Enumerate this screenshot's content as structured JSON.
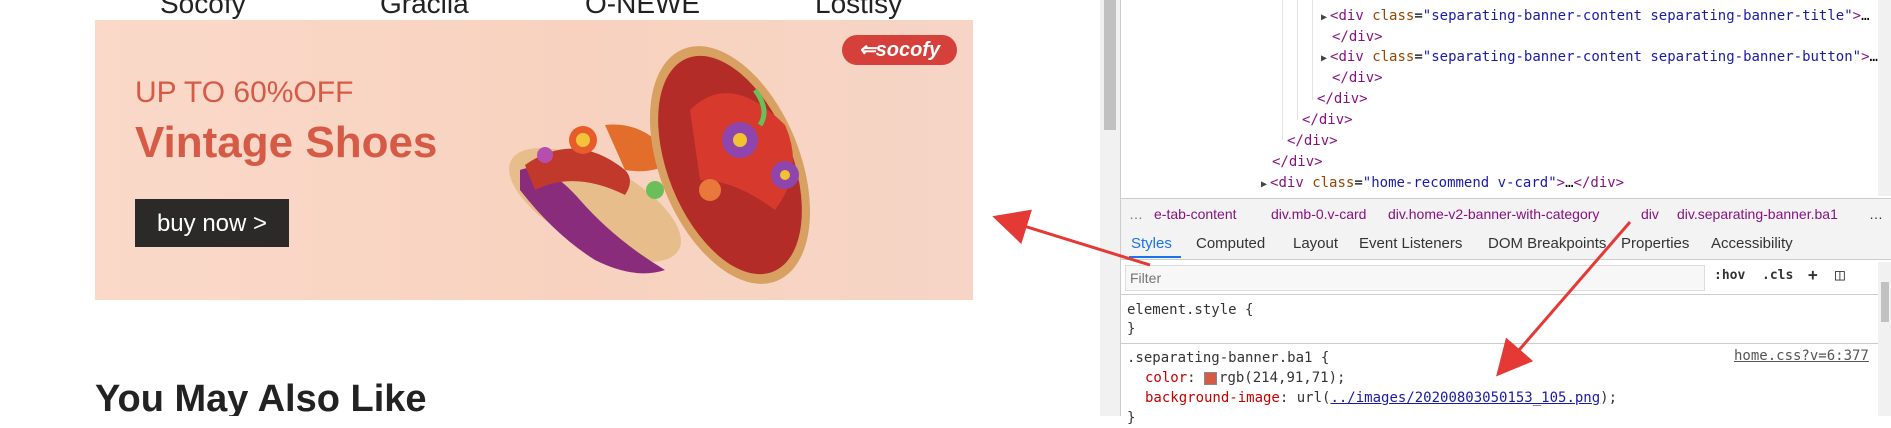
{
  "brands": [
    "Socofy",
    "Gracila",
    "O-NEWE",
    "Lostisy"
  ],
  "banner": {
    "promo": "UP TO 60%OFF",
    "headline": "Vintage Shoes",
    "button": "buy now >",
    "logo": "socofy",
    "text_color": "#d65b47",
    "background_color": "#f9d5c3"
  },
  "section_title": "You May Also Like",
  "devtools": {
    "elements_lines": [
      {
        "type": "div",
        "text": "<div class=\"separating-banner-content separating-banner-title\">…",
        "indent": 0
      },
      {
        "type": "close",
        "text": "</div>",
        "indent": 0
      },
      {
        "type": "div",
        "text": "<div class=\"separating-banner-content separating-banner-button\">…",
        "indent": 0
      },
      {
        "type": "close",
        "text": "</div>",
        "indent": 0
      },
      {
        "type": "close",
        "text": "</div>",
        "indent": 1
      },
      {
        "type": "close",
        "text": "</div>",
        "indent": 2
      },
      {
        "type": "close",
        "text": "</div>",
        "indent": 3
      },
      {
        "type": "close",
        "text": "</div>",
        "indent": 4
      },
      {
        "type": "div",
        "text": "<div class=\"home-recommend v-card\">…</div>",
        "indent": 5
      }
    ],
    "breadcrumbs": [
      "…",
      "e-tab-content",
      "div.mb-0.v-card",
      "div.home-v2-banner-with-category",
      "div",
      "div.separating-banner.ba1",
      "…"
    ],
    "tabs": [
      "Styles",
      "Computed",
      "Layout",
      "Event Listeners",
      "DOM Breakpoints",
      "Properties",
      "Accessibility"
    ],
    "active_tab": "Styles",
    "filter_placeholder": "Filter",
    "filter_buttons": [
      ":hov",
      ".cls",
      "+",
      "◫"
    ],
    "styles": {
      "element_style": "element.style {",
      "element_style_close": "}",
      "rule_selector": ".separating-banner.ba1 {",
      "rule_source": "home.css?v=6:377",
      "color_prop": "color",
      "color_value": "rgb(214,91,71);",
      "bg_prop": "background-image",
      "bg_value_prefix": "url(",
      "bg_url": "../images/20200803050153_105.png",
      "bg_value_suffix": ");",
      "rule_close": "}",
      "swatch_color": "#d65b47"
    }
  }
}
